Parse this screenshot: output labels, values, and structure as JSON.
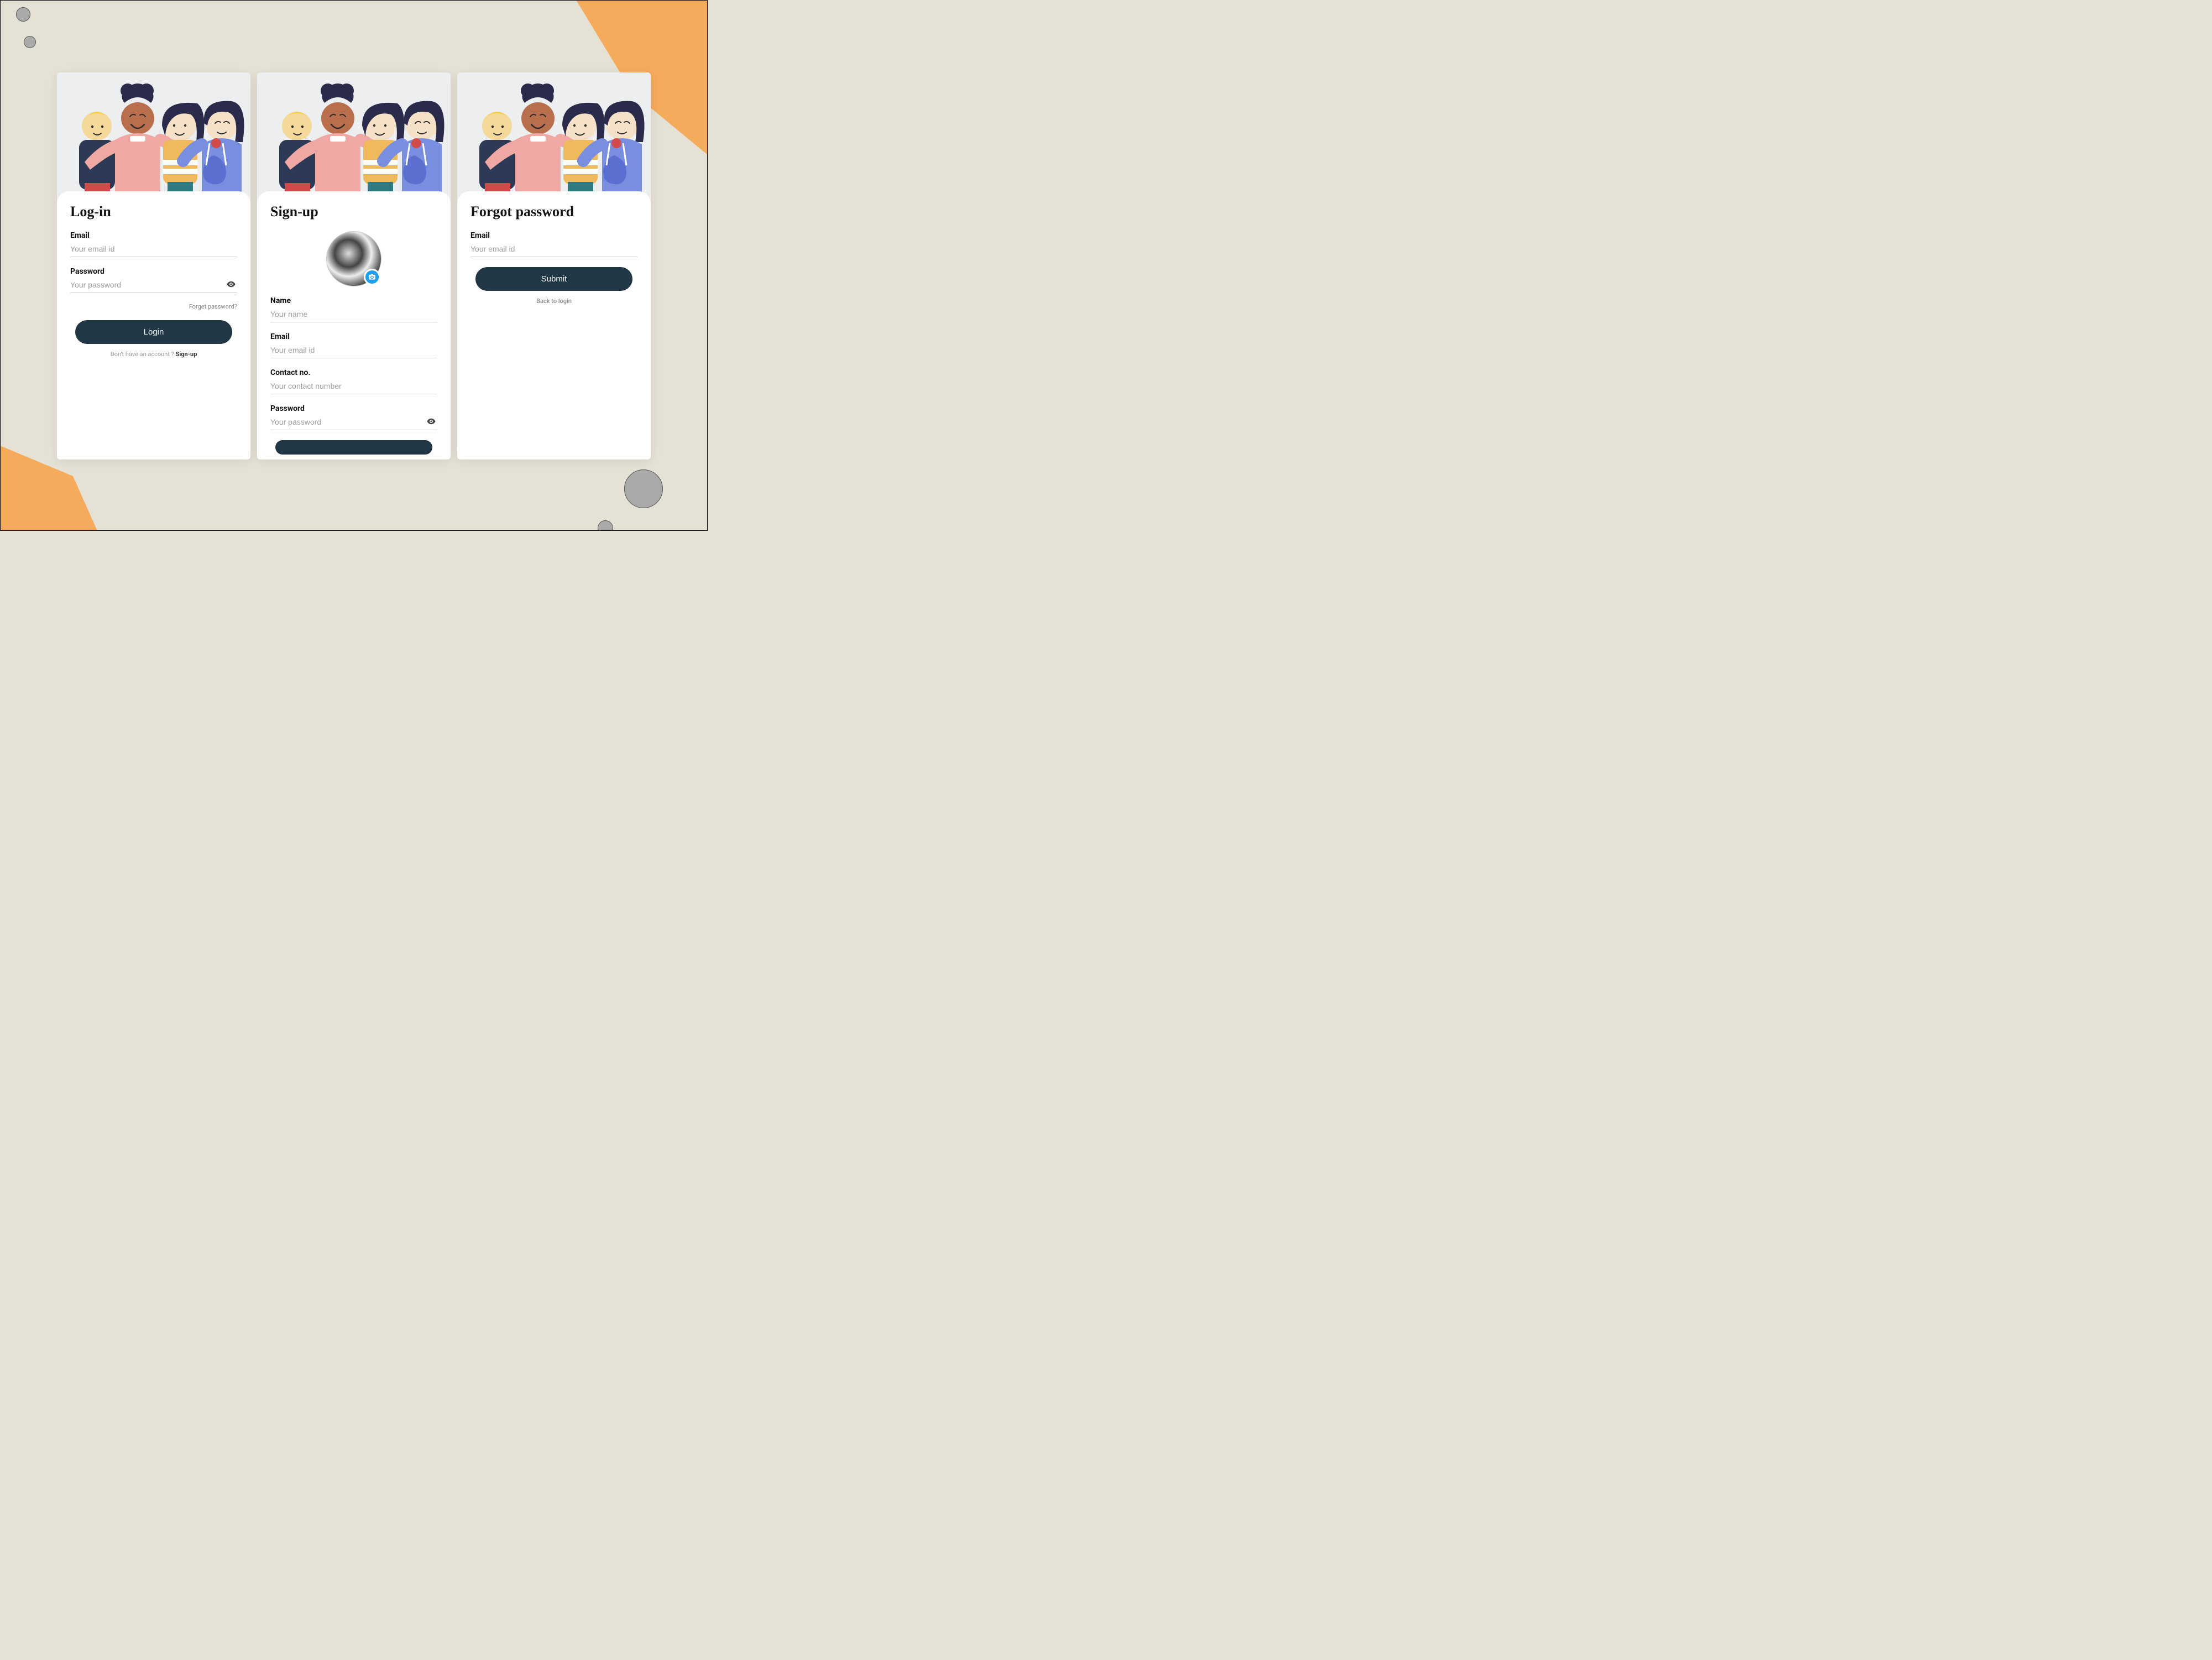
{
  "login": {
    "title": "Log-in",
    "email_label": "Email",
    "email_placeholder": "Your email id",
    "password_label": "Password",
    "password_placeholder": "Your password",
    "forgot_link": "Forget password?",
    "button": "Login",
    "footer_text": "Don't have an account ? ",
    "footer_link": "Sign-up"
  },
  "signup": {
    "title": "Sign-up",
    "name_label": "Name",
    "name_placeholder": "Your name",
    "email_label": "Email",
    "email_placeholder": "Your email id",
    "contact_label": "Contact no.",
    "contact_placeholder": "Your contact number",
    "password_label": "Password",
    "password_placeholder": "Your password"
  },
  "forgot": {
    "title": "Forgot password",
    "email_label": "Email",
    "email_placeholder": "Your email id",
    "button": "Submit",
    "back_link": "Back to login"
  },
  "colors": {
    "primary_button": "#223746",
    "accent_orange": "#f5ab5c",
    "background": "#e5e1d5",
    "camera_badge": "#1e9ff0"
  }
}
